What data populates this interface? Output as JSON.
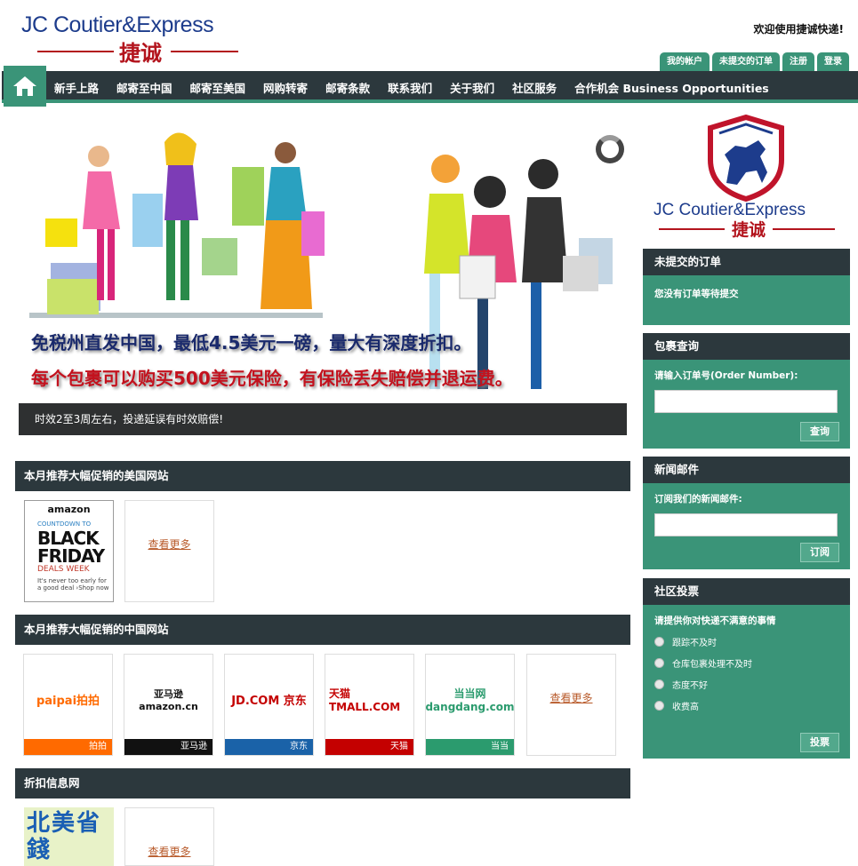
{
  "header": {
    "logo_en": "JC Coutier&Express",
    "logo_cn": "捷诚",
    "welcome": "欢迎使用捷诚快递!",
    "tabs": [
      "我的帐户",
      "未提交的订单",
      "注册",
      "登录"
    ]
  },
  "nav": {
    "items": [
      "新手上路",
      "邮寄至中国",
      "邮寄至美国",
      "网购转寄",
      "邮寄条款",
      "联系我们",
      "关于我们",
      "社区服务",
      "合作机会 Business Opportunities"
    ]
  },
  "slider": {
    "line1": "免税州直发中国，最低4.5美元一磅，量大有深度折扣。",
    "line2": "每个包裹可以购买500美元保险，有保险丢失赔偿并退运费。",
    "caption": "时效2至3周左右，投递延误有时效赔偿!"
  },
  "sections": {
    "us_sites": {
      "title": "本月推荐大幅促销的美国网站",
      "amazon_ad": {
        "brand": "amazon",
        "line1": "COUNTDOWN TO",
        "line2": "BLACK",
        "line3": "FRIDAY",
        "line4": "DEALS WEEK",
        "line5": "It's never too early for",
        "line6": "a good deal ›Shop now"
      },
      "more": "查看更多"
    },
    "cn_sites": {
      "title": "本月推荐大幅促销的中国网站",
      "tiles": [
        {
          "logo": "paipai拍拍",
          "label": "拍拍",
          "color": "#ff6a00"
        },
        {
          "logo": "亚马逊 amazon.cn",
          "label": "亚马逊",
          "color": "#111111"
        },
        {
          "logo": "JD.COM 京东",
          "label": "京东",
          "color": "#1a62a8"
        },
        {
          "logo": "天猫 TMALL.COM",
          "label": "天猫",
          "color": "#c40000"
        },
        {
          "logo": "当当网 dangdang.com",
          "label": "当当",
          "color": "#2b9b6e"
        }
      ],
      "more": "查看更多"
    },
    "discount": {
      "title": "折扣信息网",
      "tile_text": "北美省錢",
      "more": "查看更多"
    }
  },
  "sidebar": {
    "logo_en": "JC Coutier&Express",
    "logo_cn": "捷诚",
    "pending": {
      "title": "未提交的订单",
      "text": "您没有订单等待提交"
    },
    "tracking": {
      "title": "包裹查询",
      "label": "请输入订单号(Order Number):",
      "button": "查询"
    },
    "newsletter": {
      "title": "新闻邮件",
      "label": "订阅我们的新闻邮件:",
      "button": "订阅"
    },
    "poll": {
      "title": "社区投票",
      "question": "请提供你对快递不满意的事情",
      "options": [
        "跟踪不及时",
        "仓库包裹处理不及时",
        "态度不好",
        "收费高"
      ],
      "button": "投票"
    }
  }
}
